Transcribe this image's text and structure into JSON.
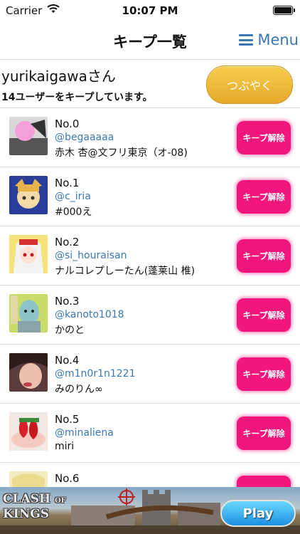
{
  "status_bar": {
    "carrier": "Carrier",
    "time": "10:07 PM"
  },
  "nav": {
    "title": "キープ一覧",
    "menu_label": "Menu"
  },
  "profile": {
    "username": "yurikaigawaさん",
    "kept_count_text": "14ユーザーをキープしています。",
    "tweet_button_label": "つぶやく"
  },
  "unkeep_label": "キープ解除",
  "users": [
    {
      "no": "No.0",
      "handle": "@begaaaaa",
      "name": "赤木 杏@文フリ東京（オ-08)"
    },
    {
      "no": "No.1",
      "handle": "@c_iria",
      "name": "#000え"
    },
    {
      "no": "No.2",
      "handle": "@si_houraisan",
      "name": "ナルコレプしーたん(蓬莱山 椎)"
    },
    {
      "no": "No.3",
      "handle": "@kanoto1018",
      "name": "かのと"
    },
    {
      "no": "No.4",
      "handle": "@m1n0r1n1221",
      "name": "みのりん∞"
    },
    {
      "no": "No.5",
      "handle": "@minaliena",
      "name": "miri"
    },
    {
      "no": "No.6",
      "handle": "",
      "name": ""
    }
  ],
  "ad": {
    "logo_line1": "CLASH",
    "logo_of": "OF",
    "logo_line2": "KINGS",
    "play_label": "Play"
  },
  "colors": {
    "accent_blue": "#3a78b5",
    "unkeep_pink": "#f2157c",
    "tweet_gold": "#e6a92b"
  }
}
